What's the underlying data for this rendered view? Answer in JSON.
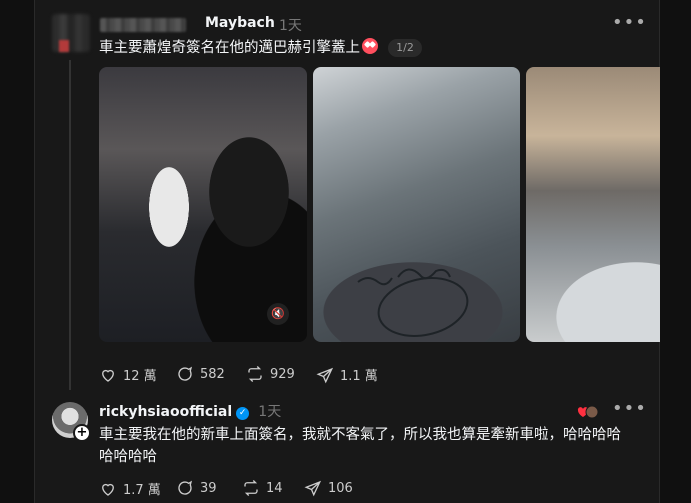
{
  "post1": {
    "username": "Maybach",
    "time": "1天",
    "text": "車主要蕭煌奇簽名在他的邁巴赫引擎蓋上",
    "media_counter": "1/2",
    "stats": {
      "likes": "12 萬",
      "comments": "582",
      "reposts": "929",
      "shares": "1.1 萬"
    }
  },
  "post2": {
    "username": "rickyhsiaoofficial",
    "time": "1天",
    "text_line1": "車主要我在他的新車上面簽名，我就不客氣了，所以我也算是牽新車啦，哈哈哈哈",
    "text_line2": "哈哈哈哈",
    "stats": {
      "likes": "1.7 萬",
      "comments": "39",
      "reposts": "14",
      "shares": "106"
    }
  },
  "icons": {
    "more": "more-icon",
    "like": "heart-icon",
    "comment": "comment-icon",
    "repost": "repost-icon",
    "share": "share-icon",
    "mute": "mute-icon",
    "verified": "verified-icon"
  },
  "colors": {
    "background": "#101010",
    "card": "#181818",
    "verified": "#0095f6",
    "text": "#f3f5f7",
    "muted": "#777777"
  }
}
